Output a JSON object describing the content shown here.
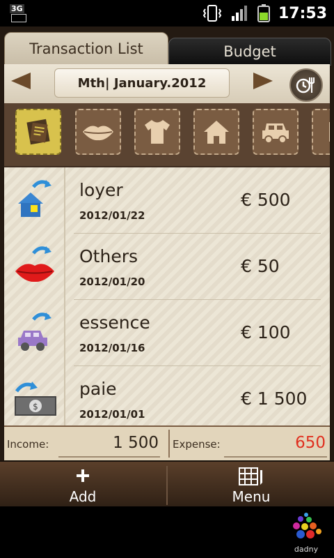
{
  "status_bar": {
    "network_label": "3G",
    "time": "17:53"
  },
  "tabs": [
    {
      "label": "Transaction List",
      "active": true
    },
    {
      "label": "Budget",
      "active": false
    }
  ],
  "month_nav": {
    "current": "Mth| January.2012"
  },
  "categories": [
    {
      "name": "notes-icon",
      "selected": true
    },
    {
      "name": "lips-icon",
      "selected": false
    },
    {
      "name": "shirt-icon",
      "selected": false
    },
    {
      "name": "house-icon",
      "selected": false
    },
    {
      "name": "car-icon",
      "selected": false
    },
    {
      "name": "more-icon",
      "selected": false
    }
  ],
  "transactions": [
    {
      "name": "loyer",
      "date": "2012/01/22",
      "amount": "€ 500",
      "icon": "house-recurring-icon"
    },
    {
      "name": "Others",
      "date": "2012/01/20",
      "amount": "€ 50",
      "icon": "lips-recurring-icon"
    },
    {
      "name": "essence",
      "date": "2012/01/16",
      "amount": "€ 100",
      "icon": "car-recurring-icon"
    },
    {
      "name": "paie",
      "date": "2012/01/01",
      "amount": "€ 1 500",
      "icon": "money-recurring-icon"
    }
  ],
  "summary": {
    "income_label": "Income:",
    "income_value": "1 500",
    "expense_label": "Expense:",
    "expense_value": "650",
    "expense_color": "#e03020"
  },
  "bottom_bar": {
    "add_label": "Add",
    "menu_label": "Menu"
  },
  "ad": {
    "brand": "dadny"
  }
}
